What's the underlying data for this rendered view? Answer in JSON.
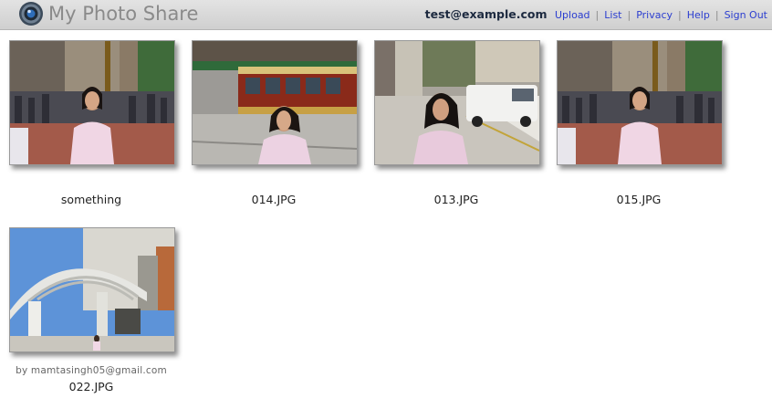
{
  "app": {
    "title": "My Photo Share",
    "logo_icon": "camera-lens-icon"
  },
  "nav": {
    "user_email": "test@example.com",
    "links": [
      "Upload",
      "List",
      "Privacy",
      "Help",
      "Sign Out"
    ],
    "separator": "|"
  },
  "colors": {
    "link": "#2b3ed0",
    "header_bg": "#d6d6d6",
    "user_text": "#1d2a40"
  },
  "photos": [
    {
      "caption": "something",
      "byline": ""
    },
    {
      "caption": "014.JPG",
      "byline": ""
    },
    {
      "caption": "013.JPG",
      "byline": ""
    },
    {
      "caption": "015.JPG",
      "byline": ""
    },
    {
      "caption": "022.JPG",
      "byline": "by mamtasingh05@gmail.com"
    }
  ]
}
